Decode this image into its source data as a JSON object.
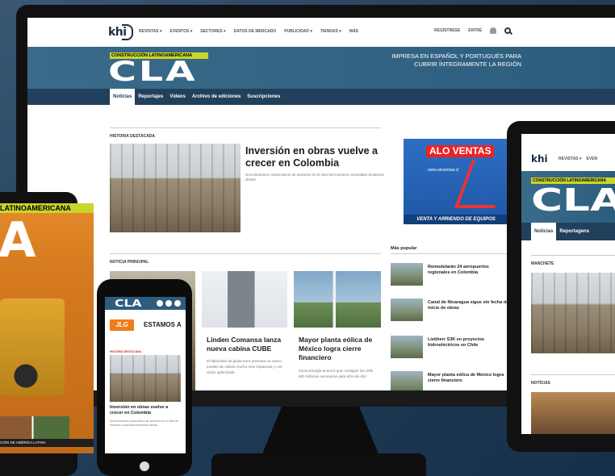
{
  "monitor": {
    "nav": {
      "logo": "khi",
      "links": [
        "REVISTAS ▾",
        "EVENTOS ▾",
        "SECTORES ▾",
        "DATOS DE MERCADO",
        "PUBLICIDAD ▾",
        "TIENDAS ▾",
        "MÁS"
      ],
      "register": "REGÍSTRESE",
      "login": "ENTRE"
    },
    "header": {
      "strip": "CONSTRUCCIÓN LATINOAMERICANA",
      "logo": "CLA",
      "tagline": "IMPRESA EN ESPAÑOL Y PORTUGUÉS PARA CUBRIR ÍNTEGRAMENTE LA REGIÓN"
    },
    "subnav": [
      "Noticias",
      "Reportajes",
      "Videos",
      "Archivo de ediciones",
      "Suscripciones"
    ],
    "featured": {
      "label": "HISTORIA DESTACADA",
      "title": "Inversión en obras vuelve a crecer en Colombia",
      "body": "Dos trimestres consecutivos de aumento en el nivel de inversión consolidan tendencia alcista"
    },
    "main_label": "NOTICIA PRINCIPAL",
    "articles": [
      {
        "title": "Linden Comansa lanza nueva cabina CUBE",
        "body": "El fabricante de grúas torre presenta un nuevo modelo de cabina mucho más espaciosa y con visión optimizada"
      },
      {
        "title": "Mayor planta eólica de México logra cierre financiero",
        "body": "Zuma Energía anunció que consiguió los US$ 600 millones necesarios para obra de 424"
      }
    ],
    "ad": {
      "title": "ALO VENTAS",
      "url": "www.aloventas.cl",
      "footer": "VENTA Y ARRIENDO DE EQUIPOS"
    },
    "popular": {
      "heading": "Más popular",
      "items": [
        "Remodelarán 24 aeropuertos regionales en Colombia",
        "Canal de Nicaragua sigue sin fecha de inicio de obras",
        "Liebherr S3K en proyectos hidroeléctricos en Chile",
        "Mayor planta eólica de México logra cierre financiero"
      ]
    }
  },
  "tablet_left": {
    "band": "LATINOAMERICANA",
    "logo": "A",
    "footer": "CIÓN DE AMÉRICA LATINA"
  },
  "phone": {
    "logo": "CLA",
    "ad_brand": "JLG",
    "ad_text": "ESTAMOS A",
    "label": "HISTORIA DESTACADA",
    "title": "Inversión en obras vuelve a crecer en Colombia",
    "body": "Dos trimestres consecutivos de aumento en el nivel de inversión consolidan tendencia alcista"
  },
  "tablet_right": {
    "logo": "khi",
    "links": [
      "REVISTAS ▾",
      "EVEN"
    ],
    "strip": "CONSTRUCCIÓN LATINOAMERICANA",
    "cla": "CLA",
    "subnav": [
      "Noticias",
      "Reportagens"
    ],
    "label1": "MANCHETE",
    "label2": "NOTÍCIAS"
  }
}
